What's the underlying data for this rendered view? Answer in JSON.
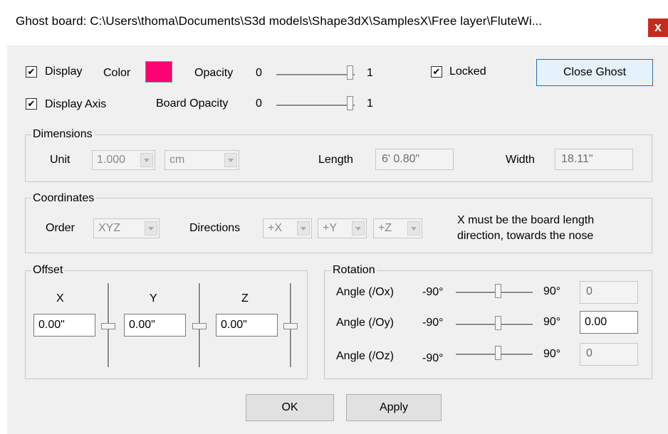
{
  "window": {
    "title": "Ghost board: C:\\Users\\thoma\\Documents\\S3d models\\Shape3dX\\SamplesX\\Free layer\\FluteWi...",
    "close_glyph": "x"
  },
  "display": {
    "display_label": "Display",
    "display_checked": true,
    "color_label": "Color",
    "color_value": "#ff0073",
    "opacity_label": "Opacity",
    "opacity_min": "0",
    "opacity_max": "1",
    "opacity_value": 1,
    "locked_label": "Locked",
    "locked_checked": true,
    "close_ghost_label": "Close Ghost",
    "display_axis_label": "Display Axis",
    "display_axis_checked": true,
    "board_opacity_label": "Board Opacity",
    "board_opacity_min": "0",
    "board_opacity_max": "1",
    "board_opacity_value": 1
  },
  "dimensions": {
    "title": "Dimensions",
    "unit_label": "Unit",
    "unit_scale": "1.000",
    "unit_name": "cm",
    "length_label": "Length",
    "length_value": "6' 0.80\"",
    "width_label": "Width",
    "width_value": "18.11\""
  },
  "coordinates": {
    "title": "Coordinates",
    "order_label": "Order",
    "order_value": "XYZ",
    "directions_label": "Directions",
    "dir_x": "+X",
    "dir_y": "+Y",
    "dir_z": "+Z",
    "note_line1": "X must be the board length",
    "note_line2": "direction, towards the nose"
  },
  "offset": {
    "title": "Offset",
    "x_label": "X",
    "y_label": "Y",
    "z_label": "Z",
    "x_value": "0.00\"",
    "y_value": "0.00\"",
    "z_value": "0.00\""
  },
  "rotation": {
    "title": "Rotation",
    "rows": [
      {
        "label": "Angle (/Ox)",
        "min": "-90°",
        "max": "90°",
        "value": "0",
        "enabled": false
      },
      {
        "label": "Angle (/Oy)",
        "min": "-90°",
        "max": "90°",
        "value": "0.00",
        "enabled": true
      },
      {
        "label": "Angle (/Oz)",
        "min": "-90°",
        "max": "90°",
        "value": "0",
        "enabled": false
      }
    ]
  },
  "buttons": {
    "ok_label": "OK",
    "apply_label": "Apply"
  },
  "colors": {
    "accent_border": "#0078d7",
    "close_red": "#c42b1c",
    "ghost_color": "#ff0073"
  }
}
